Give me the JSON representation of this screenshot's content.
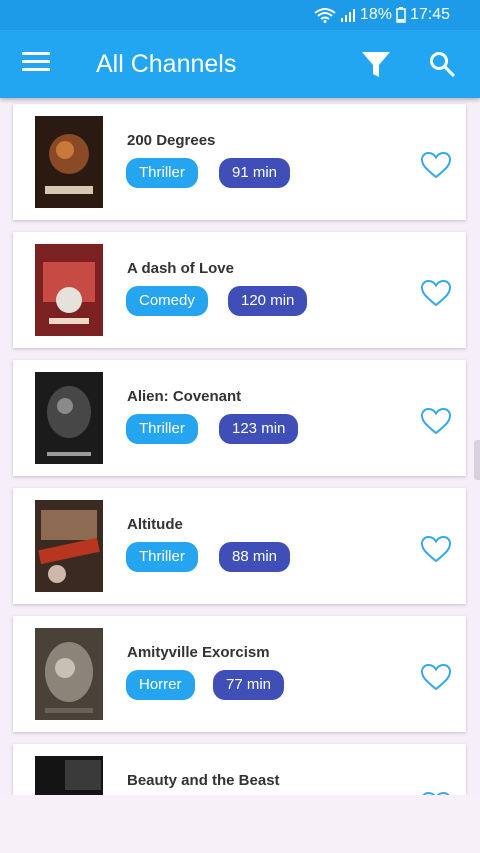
{
  "status": {
    "wifi_icon": "wifi-icon",
    "signal_icon": "signal-icon",
    "battery": "18%",
    "time": "17:45"
  },
  "appbar": {
    "title": "All Channels",
    "menu_icon": "menu-icon",
    "filter_icon": "filter-icon",
    "search_icon": "search-icon"
  },
  "items": [
    {
      "title": "200 Degrees",
      "genre": "Thriller",
      "duration": "91 min"
    },
    {
      "title": "A dash of Love",
      "genre": "Comedy",
      "duration": "120 min"
    },
    {
      "title": "Alien: Covenant",
      "genre": "Thriller",
      "duration": "123 min"
    },
    {
      "title": "Altitude",
      "genre": "Thriller",
      "duration": "88 min"
    },
    {
      "title": "Amityville Exorcism",
      "genre": "Horrer",
      "duration": "77 min"
    },
    {
      "title": "Beauty and the Beast",
      "genre": "",
      "duration": ""
    }
  ],
  "colors": {
    "primary": "#23a6f2",
    "genre": "#25a5f0",
    "duration": "#3f4fb7",
    "heart": "#39a7ef"
  }
}
